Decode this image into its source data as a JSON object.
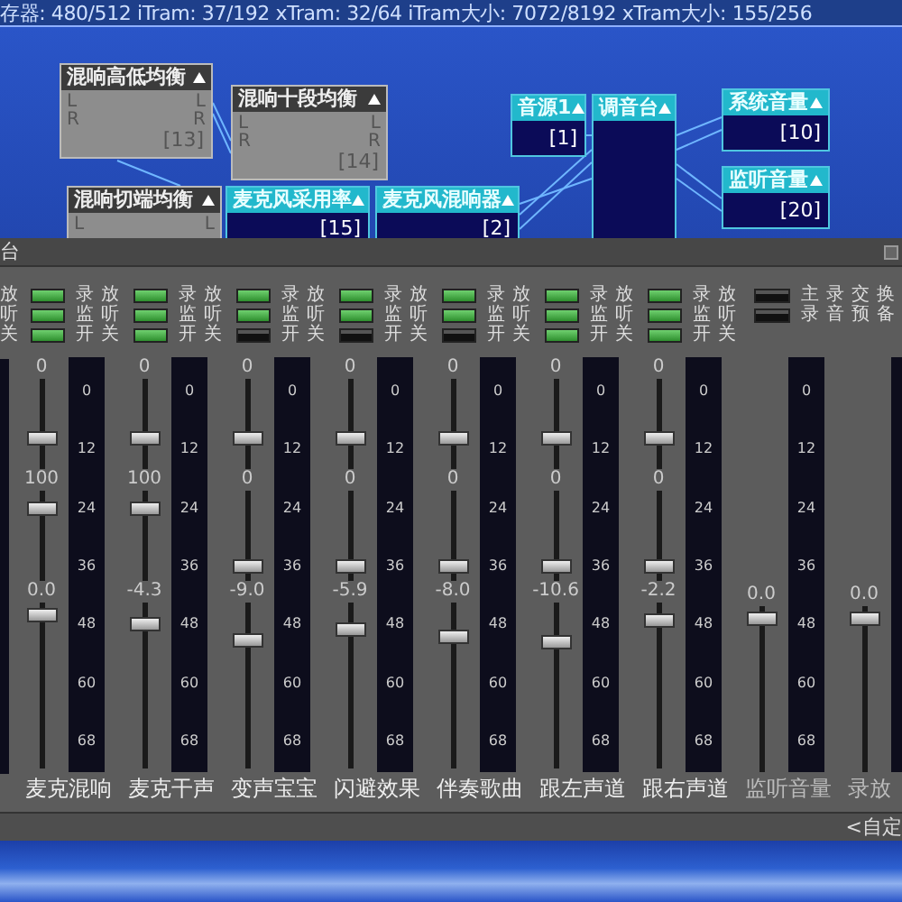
{
  "status_text": "存器: 480/512 iTram: 37/192 xTram: 32/64 iTram大小: 7072/8192 xTram大小: 155/256",
  "nodes": [
    {
      "title": "混响高低均衡",
      "kind": "effect",
      "ports_left": [
        "L",
        "R"
      ],
      "ports_right": [
        "L",
        "R"
      ],
      "index": "[13]"
    },
    {
      "title": "混响十段均衡",
      "kind": "effect",
      "ports_left": [
        "L",
        "R"
      ],
      "ports_right": [
        "L",
        "R"
      ],
      "index": "[14]"
    },
    {
      "title": "混响切端均衡",
      "kind": "effect",
      "ports_left": [
        "L"
      ],
      "ports_right": [
        "L"
      ]
    },
    {
      "title": "麦克风采用率",
      "kind": "device",
      "index": "[15]"
    },
    {
      "title": "麦克风混响器",
      "kind": "device",
      "index": "[2]"
    },
    {
      "title": "音源1",
      "kind": "device",
      "index": "[1]"
    },
    {
      "title": "调音台",
      "kind": "device"
    },
    {
      "title": "系统音量",
      "kind": "device",
      "index": "[10]"
    },
    {
      "title": "监听音量",
      "kind": "device",
      "index": "[20]"
    }
  ],
  "mixer": {
    "title": "台",
    "partial_labels": [
      "放",
      "听",
      "关"
    ],
    "strips": [
      {
        "kind": "channel",
        "name": "麦克混响",
        "toggles": [
          {
            "label": "录放",
            "on": true
          },
          {
            "label": "监听",
            "on": true
          },
          {
            "label": "开关",
            "on": true
          }
        ],
        "faders": [
          {
            "label": "0",
            "level": 0.3
          },
          {
            "label": "100",
            "level": 0.85
          },
          {
            "label": "0.0",
            "level": 0.97
          }
        ],
        "ticks": [
          "0",
          "12",
          "24",
          "36",
          "48",
          "60",
          "68"
        ]
      },
      {
        "kind": "channel",
        "name": "麦克干声",
        "toggles": [
          {
            "label": "录放",
            "on": true
          },
          {
            "label": "监听",
            "on": true
          },
          {
            "label": "开关",
            "on": true
          }
        ],
        "faders": [
          {
            "label": "0",
            "level": 0.3
          },
          {
            "label": "100",
            "level": 0.85
          },
          {
            "label": "-4.3",
            "level": 0.9
          }
        ],
        "ticks": [
          "0",
          "12",
          "24",
          "36",
          "48",
          "60",
          "68"
        ]
      },
      {
        "kind": "channel",
        "name": "变声宝宝",
        "toggles": [
          {
            "label": "录放",
            "on": true
          },
          {
            "label": "监听",
            "on": true
          },
          {
            "label": "开关",
            "on": false
          }
        ],
        "faders": [
          {
            "label": "0",
            "level": 0.3
          },
          {
            "label": "0",
            "level": 0.1
          },
          {
            "label": "-9.0",
            "level": 0.8
          }
        ],
        "ticks": [
          "0",
          "12",
          "24",
          "36",
          "48",
          "60",
          "68"
        ]
      },
      {
        "kind": "channel",
        "name": "闪避效果",
        "toggles": [
          {
            "label": "录放",
            "on": true
          },
          {
            "label": "监听",
            "on": true
          },
          {
            "label": "开关",
            "on": false
          }
        ],
        "faders": [
          {
            "label": "0",
            "level": 0.3
          },
          {
            "label": "0",
            "level": 0.1
          },
          {
            "label": "-5.9",
            "level": 0.87
          }
        ],
        "ticks": [
          "0",
          "12",
          "24",
          "36",
          "48",
          "60",
          "68"
        ]
      },
      {
        "kind": "channel",
        "name": "伴奏歌曲",
        "toggles": [
          {
            "label": "录放",
            "on": true
          },
          {
            "label": "监听",
            "on": true
          },
          {
            "label": "开关",
            "on": false
          }
        ],
        "faders": [
          {
            "label": "0",
            "level": 0.3
          },
          {
            "label": "0",
            "level": 0.1
          },
          {
            "label": "-8.0",
            "level": 0.82
          }
        ],
        "ticks": [
          "0",
          "12",
          "24",
          "36",
          "48",
          "60",
          "68"
        ]
      },
      {
        "kind": "channel",
        "name": "跟左声道",
        "toggles": [
          {
            "label": "录放",
            "on": true
          },
          {
            "label": "监听",
            "on": true
          },
          {
            "label": "开关",
            "on": true
          }
        ],
        "faders": [
          {
            "label": "0",
            "level": 0.3
          },
          {
            "label": "0",
            "level": 0.1
          },
          {
            "label": "-10.6",
            "level": 0.78
          }
        ],
        "ticks": [
          "0",
          "12",
          "24",
          "36",
          "48",
          "60",
          "68"
        ]
      },
      {
        "kind": "channel",
        "name": "跟右声道",
        "toggles": [
          {
            "label": "录放",
            "on": true
          },
          {
            "label": "监听",
            "on": true
          },
          {
            "label": "开关",
            "on": true
          }
        ],
        "faders": [
          {
            "label": "0",
            "level": 0.3
          },
          {
            "label": "0",
            "level": 0.1
          },
          {
            "label": "-2.2",
            "level": 0.93
          }
        ],
        "ticks": [
          "0",
          "12",
          "24",
          "36",
          "48",
          "60",
          "68"
        ]
      },
      {
        "kind": "monitor",
        "name": "监听音量",
        "faders": [
          {
            "label": "0.0",
            "level": 0.97
          }
        ],
        "ticks": [
          "0",
          "12",
          "24",
          "36",
          "48",
          "60",
          "68"
        ]
      },
      {
        "kind": "monitor",
        "name": "录放",
        "faders": [
          {
            "label": "0.0",
            "level": 0.97
          }
        ]
      }
    ],
    "switches": [
      {
        "label": "主录交换",
        "on": false
      },
      {
        "label": "录音预备",
        "on": false
      }
    ],
    "footer_text": "<自定"
  }
}
